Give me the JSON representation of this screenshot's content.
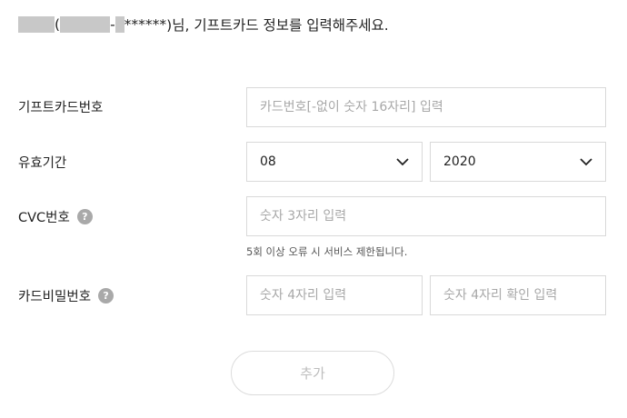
{
  "header": {
    "paren_open": "(",
    "dash": "-",
    "stars": "******",
    "suffix": ")님, 기프트카드 정보를 입력해주세요."
  },
  "form": {
    "card_number": {
      "label": "기프트카드번호",
      "placeholder": "카드번호[-없이 숫자 16자리] 입력"
    },
    "expiry": {
      "label": "유효기간",
      "month": "08",
      "year": "2020"
    },
    "cvc": {
      "label": "CVC번호",
      "help": "?",
      "placeholder": "숫자 3자리 입력",
      "note": "5회 이상 오류 시 서비스 제한됩니다."
    },
    "password": {
      "label": "카드비밀번호",
      "help": "?",
      "placeholder": "숫자 4자리 입력",
      "confirm_placeholder": "숫자 4자리 확인 입력"
    }
  },
  "add_button": "추가",
  "icons": {
    "help": "question-circle-icon",
    "dropdown": "chevron-down-icon"
  }
}
